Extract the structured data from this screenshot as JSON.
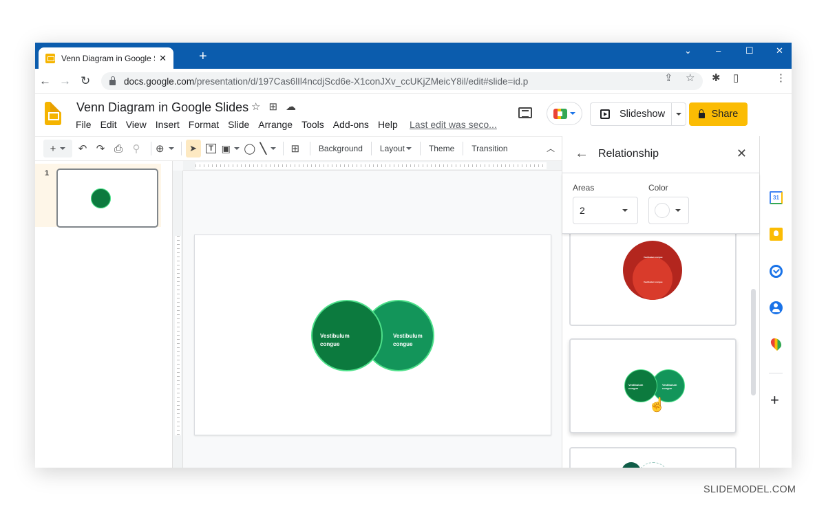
{
  "browser": {
    "tab_title": "Venn Diagram in Google Slides -",
    "tab_close": "✕",
    "new_tab": "+",
    "window_controls": {
      "dropdown": "⌄",
      "minimize": "–",
      "maximize": "☐",
      "close": "✕"
    },
    "url_domain": "docs.google.com",
    "url_path": "/presentation/d/197Cas6lIl4ncdjScd6e-X1conJXv_ccUKjZMeicY8il/edit#slide=id.p",
    "nav": {
      "back": "←",
      "forward": "→",
      "reload": "↻"
    },
    "omnibox_icons": {
      "share": "⇪",
      "bookmark": "☆",
      "extensions": "✱",
      "sidepanel": "▯",
      "menu": "⋮"
    }
  },
  "docs": {
    "title": "Venn Diagram in Google Slides",
    "title_icons": {
      "star": "☆",
      "move": "⊞",
      "cloud": "☁"
    },
    "menu": [
      "File",
      "Edit",
      "View",
      "Insert",
      "Format",
      "Slide",
      "Arrange",
      "Tools",
      "Add-ons",
      "Help"
    ],
    "last_edit": "Last edit was seco...",
    "slideshow_label": "Slideshow",
    "share_label": "Share"
  },
  "toolbar": {
    "plus": "+",
    "undo": "↶",
    "redo": "↷",
    "print": "⎙",
    "paint_format": "⚲",
    "zoom": "⊕",
    "select": "➤",
    "textbox": "T",
    "image": "▣",
    "shape": "◯",
    "line": "╲",
    "comment": "⊞",
    "background_label": "Background",
    "layout_label": "Layout",
    "theme_label": "Theme",
    "transition_label": "Transition",
    "collapse": "︿"
  },
  "filmstrip": {
    "slides": [
      {
        "number": "1"
      }
    ]
  },
  "slide": {
    "circles": [
      {
        "label_line1": "Vestibulum",
        "label_line2": "congue",
        "color": "#0c7a3e"
      },
      {
        "label_line1": "Vestibulum",
        "label_line2": "congue",
        "color": "#13955a"
      }
    ]
  },
  "panel": {
    "back": "←",
    "title": "Relationship",
    "close": "✕",
    "areas_label": "Areas",
    "areas_value": "2",
    "color_label": "Color",
    "cards": [
      {
        "type": "nested",
        "outer_color": "#b3261e",
        "inner_color": "#d93b2b",
        "label": "Vestibulum congue"
      },
      {
        "type": "venn",
        "left_color": "#0c7a3e",
        "right_color": "#13955a",
        "label_line1": "Vestibulum",
        "label_line2": "congue"
      },
      {
        "type": "partial",
        "color": "#0f5c47"
      }
    ]
  },
  "addons": {
    "calendar_text": "31",
    "add": "+"
  },
  "watermark": "SLIDEMODEL.COM"
}
